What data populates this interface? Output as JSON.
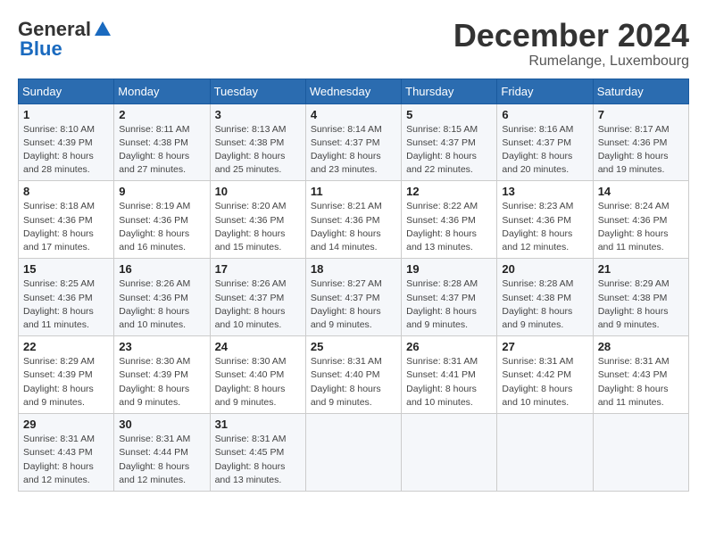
{
  "logo": {
    "general": "General",
    "blue": "Blue"
  },
  "title": "December 2024",
  "location": "Rumelange, Luxembourg",
  "days_header": [
    "Sunday",
    "Monday",
    "Tuesday",
    "Wednesday",
    "Thursday",
    "Friday",
    "Saturday"
  ],
  "weeks": [
    [
      {
        "day": "1",
        "sunrise": "8:10 AM",
        "sunset": "4:39 PM",
        "daylight": "8 hours and 28 minutes."
      },
      {
        "day": "2",
        "sunrise": "8:11 AM",
        "sunset": "4:38 PM",
        "daylight": "8 hours and 27 minutes."
      },
      {
        "day": "3",
        "sunrise": "8:13 AM",
        "sunset": "4:38 PM",
        "daylight": "8 hours and 25 minutes."
      },
      {
        "day": "4",
        "sunrise": "8:14 AM",
        "sunset": "4:37 PM",
        "daylight": "8 hours and 23 minutes."
      },
      {
        "day": "5",
        "sunrise": "8:15 AM",
        "sunset": "4:37 PM",
        "daylight": "8 hours and 22 minutes."
      },
      {
        "day": "6",
        "sunrise": "8:16 AM",
        "sunset": "4:37 PM",
        "daylight": "8 hours and 20 minutes."
      },
      {
        "day": "7",
        "sunrise": "8:17 AM",
        "sunset": "4:36 PM",
        "daylight": "8 hours and 19 minutes."
      }
    ],
    [
      {
        "day": "8",
        "sunrise": "8:18 AM",
        "sunset": "4:36 PM",
        "daylight": "8 hours and 17 minutes."
      },
      {
        "day": "9",
        "sunrise": "8:19 AM",
        "sunset": "4:36 PM",
        "daylight": "8 hours and 16 minutes."
      },
      {
        "day": "10",
        "sunrise": "8:20 AM",
        "sunset": "4:36 PM",
        "daylight": "8 hours and 15 minutes."
      },
      {
        "day": "11",
        "sunrise": "8:21 AM",
        "sunset": "4:36 PM",
        "daylight": "8 hours and 14 minutes."
      },
      {
        "day": "12",
        "sunrise": "8:22 AM",
        "sunset": "4:36 PM",
        "daylight": "8 hours and 13 minutes."
      },
      {
        "day": "13",
        "sunrise": "8:23 AM",
        "sunset": "4:36 PM",
        "daylight": "8 hours and 12 minutes."
      },
      {
        "day": "14",
        "sunrise": "8:24 AM",
        "sunset": "4:36 PM",
        "daylight": "8 hours and 11 minutes."
      }
    ],
    [
      {
        "day": "15",
        "sunrise": "8:25 AM",
        "sunset": "4:36 PM",
        "daylight": "8 hours and 11 minutes."
      },
      {
        "day": "16",
        "sunrise": "8:26 AM",
        "sunset": "4:36 PM",
        "daylight": "8 hours and 10 minutes."
      },
      {
        "day": "17",
        "sunrise": "8:26 AM",
        "sunset": "4:37 PM",
        "daylight": "8 hours and 10 minutes."
      },
      {
        "day": "18",
        "sunrise": "8:27 AM",
        "sunset": "4:37 PM",
        "daylight": "8 hours and 9 minutes."
      },
      {
        "day": "19",
        "sunrise": "8:28 AM",
        "sunset": "4:37 PM",
        "daylight": "8 hours and 9 minutes."
      },
      {
        "day": "20",
        "sunrise": "8:28 AM",
        "sunset": "4:38 PM",
        "daylight": "8 hours and 9 minutes."
      },
      {
        "day": "21",
        "sunrise": "8:29 AM",
        "sunset": "4:38 PM",
        "daylight": "8 hours and 9 minutes."
      }
    ],
    [
      {
        "day": "22",
        "sunrise": "8:29 AM",
        "sunset": "4:39 PM",
        "daylight": "8 hours and 9 minutes."
      },
      {
        "day": "23",
        "sunrise": "8:30 AM",
        "sunset": "4:39 PM",
        "daylight": "8 hours and 9 minutes."
      },
      {
        "day": "24",
        "sunrise": "8:30 AM",
        "sunset": "4:40 PM",
        "daylight": "8 hours and 9 minutes."
      },
      {
        "day": "25",
        "sunrise": "8:31 AM",
        "sunset": "4:40 PM",
        "daylight": "8 hours and 9 minutes."
      },
      {
        "day": "26",
        "sunrise": "8:31 AM",
        "sunset": "4:41 PM",
        "daylight": "8 hours and 10 minutes."
      },
      {
        "day": "27",
        "sunrise": "8:31 AM",
        "sunset": "4:42 PM",
        "daylight": "8 hours and 10 minutes."
      },
      {
        "day": "28",
        "sunrise": "8:31 AM",
        "sunset": "4:43 PM",
        "daylight": "8 hours and 11 minutes."
      }
    ],
    [
      {
        "day": "29",
        "sunrise": "8:31 AM",
        "sunset": "4:43 PM",
        "daylight": "8 hours and 12 minutes."
      },
      {
        "day": "30",
        "sunrise": "8:31 AM",
        "sunset": "4:44 PM",
        "daylight": "8 hours and 12 minutes."
      },
      {
        "day": "31",
        "sunrise": "8:31 AM",
        "sunset": "4:45 PM",
        "daylight": "8 hours and 13 minutes."
      },
      null,
      null,
      null,
      null
    ]
  ]
}
